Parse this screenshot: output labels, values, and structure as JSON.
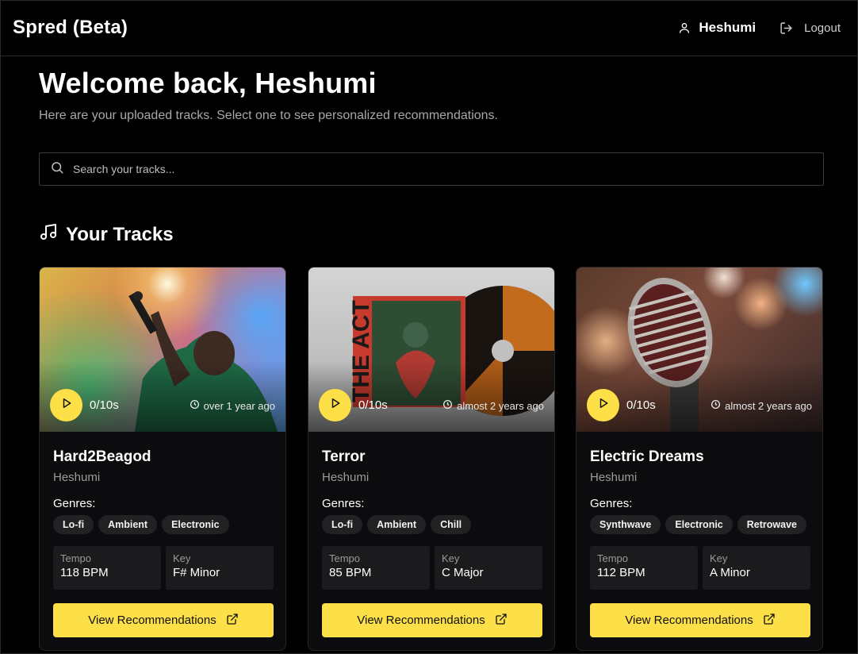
{
  "app": {
    "title": "Spred (Beta)"
  },
  "header": {
    "username": "Heshumi",
    "logout_label": "Logout"
  },
  "welcome": {
    "title": "Welcome back, Heshumi",
    "subtitle": "Here are your uploaded tracks. Select one to see personalized recommendations."
  },
  "search": {
    "placeholder": "Search your tracks..."
  },
  "section": {
    "title": "Your Tracks",
    "genres_label": "Genres:",
    "tempo_label": "Tempo",
    "key_label": "Key",
    "button_label": "View Recommendations"
  },
  "tracks": [
    {
      "title": "Hard2Beagod",
      "artist": "Heshumi",
      "timer": "0/10s",
      "uploaded": "over 1 year ago",
      "genres": [
        "Lo-fi",
        "Ambient",
        "Electronic"
      ],
      "tempo": "118 BPM",
      "key": "F# Minor"
    },
    {
      "title": "Terror",
      "artist": "Heshumi",
      "timer": "0/10s",
      "uploaded": "almost 2 years ago",
      "genres": [
        "Lo-fi",
        "Ambient",
        "Chill"
      ],
      "tempo": "85 BPM",
      "key": "C Major",
      "cover_text": "THE ACT"
    },
    {
      "title": "Electric Dreams",
      "artist": "Heshumi",
      "timer": "0/10s",
      "uploaded": "almost 2 years ago",
      "genres": [
        "Synthwave",
        "Electronic",
        "Retrowave"
      ],
      "tempo": "112 BPM",
      "key": "A Minor"
    }
  ],
  "colors": {
    "accent": "#fde047",
    "background": "#000000",
    "card": "#0c0c0e"
  }
}
